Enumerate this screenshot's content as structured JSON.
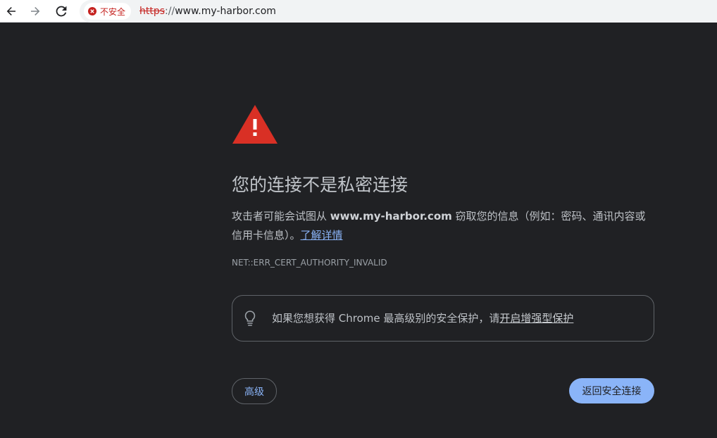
{
  "browser": {
    "security_chip_label": "不安全",
    "url_scheme": "https",
    "url_separator": "://",
    "url_host": "www.my-harbor.com"
  },
  "interstitial": {
    "heading": "您的连接不是私密连接",
    "explanation_prefix": "攻击者可能会试图从 ",
    "explanation_domain": "www.my-harbor.com",
    "explanation_suffix": " 窃取您的信息（例如：密码、通讯内容或信用卡信息）。",
    "learn_more_link": "了解详情",
    "error_code": "NET::ERR_CERT_AUTHORITY_INVALID",
    "enhanced_protection_text": "如果您想获得 Chrome 最高级别的安全保护，请",
    "enhanced_protection_link": "开启增强型保护",
    "advanced_button": "高级",
    "back_button": "返回安全连接"
  },
  "colors": {
    "page_background": "#202124",
    "warning_red": "#d93025",
    "link_blue": "#8ab4f8",
    "chip_red": "#c5221f"
  },
  "icons": [
    "back-arrow-icon",
    "forward-arrow-icon",
    "reload-icon",
    "not-secure-icon",
    "warning-triangle-icon",
    "lightbulb-icon"
  ]
}
